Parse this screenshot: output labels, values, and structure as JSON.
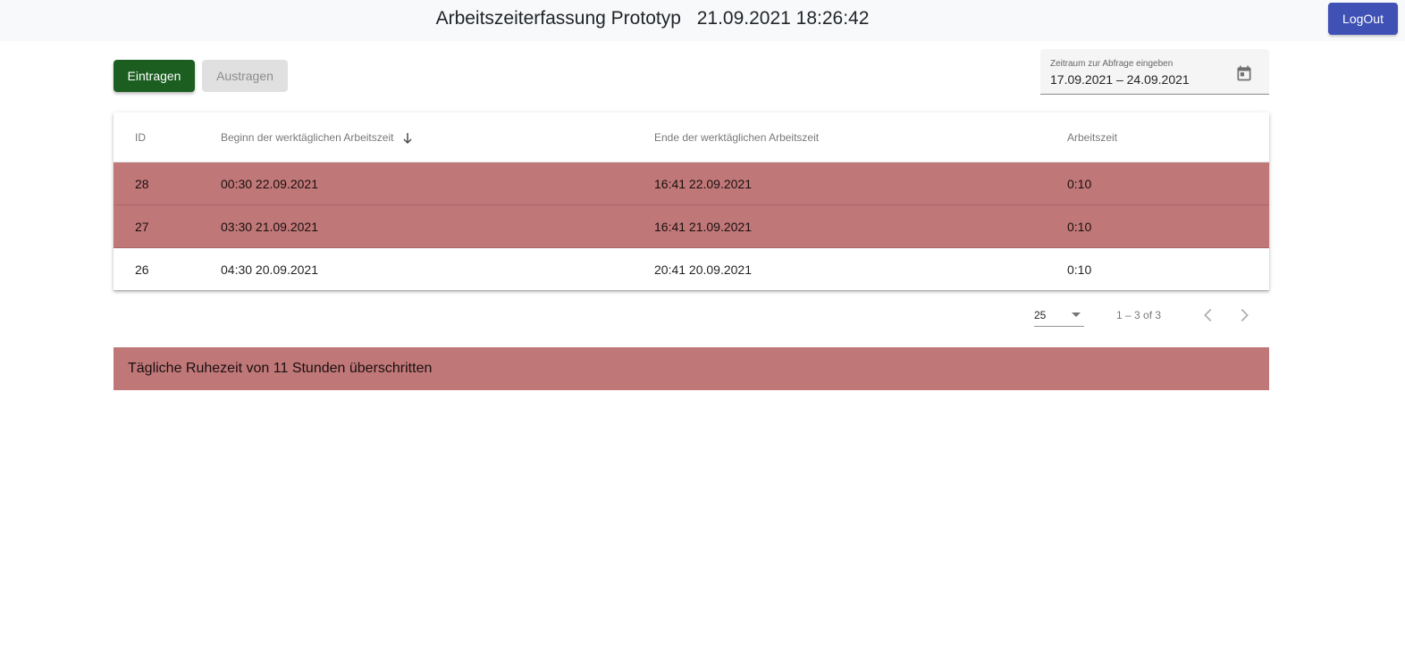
{
  "header": {
    "title": "Arbeitszeiterfassung Prototyp",
    "datetime": "21.09.2021 18:26:42",
    "logout_label": "LogOut"
  },
  "actions": {
    "eintragen_label": "Eintragen",
    "austragen_label": "Austragen"
  },
  "date_range": {
    "label": "Zeitraum zur Abfrage eingeben",
    "value": "17.09.2021 – 24.09.2021",
    "icon": "calendar-icon"
  },
  "table": {
    "columns": [
      "ID",
      "Beginn der werktäglichen Arbeitszeit",
      "Ende der werktäglichen Arbeitszeit",
      "Arbeitszeit"
    ],
    "sort_icon": "arrow-down-icon",
    "rows": [
      {
        "id": "28",
        "start": "00:30 22.09.2021",
        "end": "16:41 22.09.2021",
        "duration": "0:10",
        "warning": true
      },
      {
        "id": "27",
        "start": "03:30 21.09.2021",
        "end": "16:41 21.09.2021",
        "duration": "0:10",
        "warning": true
      },
      {
        "id": "26",
        "start": "04:30 20.09.2021",
        "end": "20:41 20.09.2021",
        "duration": "0:10",
        "warning": false
      }
    ]
  },
  "paginator": {
    "page_size": "25",
    "range_label": "1 – 3 of 3",
    "prev_icon": "chevron-left-icon",
    "next_icon": "chevron-right-icon"
  },
  "alert": {
    "text": "Tägliche Ruhezeit von 11 Stunden überschritten"
  },
  "colors": {
    "warning_row": "#c07778",
    "eintragen_button": "#1b5e20",
    "logout_button": "#3f51b5"
  }
}
